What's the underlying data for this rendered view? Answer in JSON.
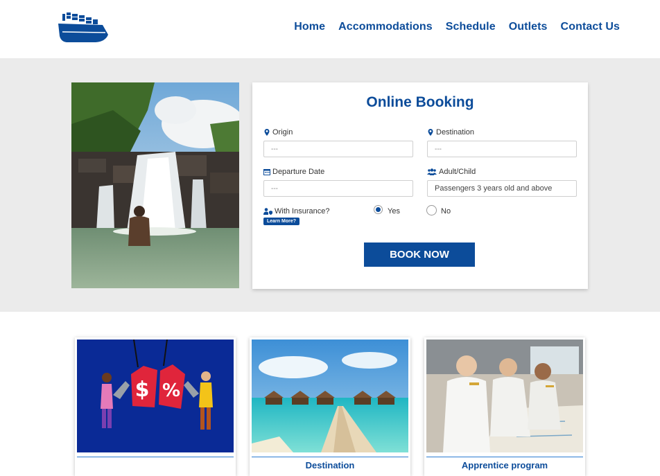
{
  "nav": {
    "items": [
      "Home",
      "Accommodations",
      "Schedule",
      "Outlets",
      "Contact Us"
    ]
  },
  "booking": {
    "title": "Online Booking",
    "origin_label": "Origin",
    "origin_value": "---",
    "destination_label": "Destination",
    "destination_value": "---",
    "departure_label": "Departure Date",
    "departure_value": "---",
    "adult_child_label": "Adult/Child",
    "adult_child_value": "Passengers 3 years old and above",
    "insurance_label": "With Insurance?",
    "learn_more": "Learn More?",
    "option_yes": "Yes",
    "option_no": "No",
    "insurance_selected": "Yes",
    "submit": "BOOK NOW"
  },
  "tiles": [
    {
      "caption": "",
      "icon": "promo-price-tags-image"
    },
    {
      "caption": "Destination",
      "icon": "beach-resort-image"
    },
    {
      "caption": "Apprentice program",
      "icon": "crew-officers-image"
    }
  ],
  "colors": {
    "brand": "#0c4c9a",
    "hero_bg": "#ebebeb"
  }
}
